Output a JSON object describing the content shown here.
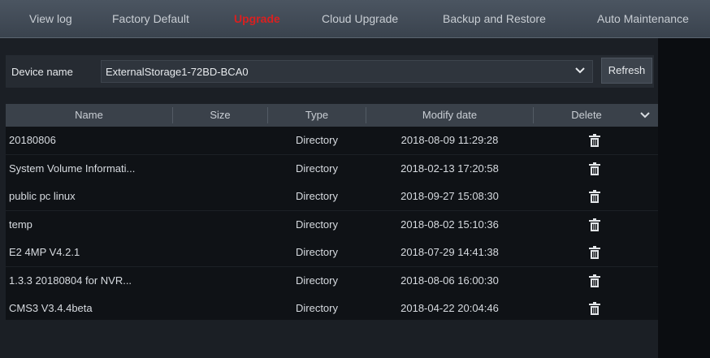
{
  "tabs": [
    {
      "label": "View log"
    },
    {
      "label": "Factory Default"
    },
    {
      "label": "Upgrade"
    },
    {
      "label": "Cloud Upgrade"
    },
    {
      "label": "Backup and Restore"
    },
    {
      "label": "Auto Maintenance"
    }
  ],
  "active_tab": "Upgrade",
  "device": {
    "label": "Device name",
    "value": "ExternalStorage1-72BD-BCA0",
    "refresh_label": "Refresh"
  },
  "table": {
    "columns": [
      "Name",
      "Size",
      "Type",
      "Modify date",
      "Delete"
    ],
    "rows": [
      {
        "name": "20180806",
        "size": "",
        "type": "Directory",
        "modified": "2018-08-09 11:29:28"
      },
      {
        "name": "System Volume Informati...",
        "size": "",
        "type": "Directory",
        "modified": "2018-02-13 17:20:58"
      },
      {
        "name": "public pc linux",
        "size": "",
        "type": "Directory",
        "modified": "2018-09-27 15:08:30"
      },
      {
        "name": "temp",
        "size": "",
        "type": "Directory",
        "modified": "2018-08-02 15:10:36"
      },
      {
        "name": "E2 4MP V4.2.1",
        "size": "",
        "type": "Directory",
        "modified": "2018-07-29 14:41:38"
      },
      {
        "name": "1.3.3 20180804 for NVR...",
        "size": "",
        "type": "Directory",
        "modified": "2018-08-06 16:00:30"
      },
      {
        "name": "CMS3 V3.4.4beta",
        "size": "",
        "type": "Directory",
        "modified": "2018-04-22 20:04:46"
      }
    ]
  },
  "icons": {
    "delete": "trash-icon",
    "dropdown": "chevron-down-icon"
  },
  "colors": {
    "active_tab": "#d92020",
    "header_bar": "#3a414a",
    "panel": "#1b1f25"
  }
}
